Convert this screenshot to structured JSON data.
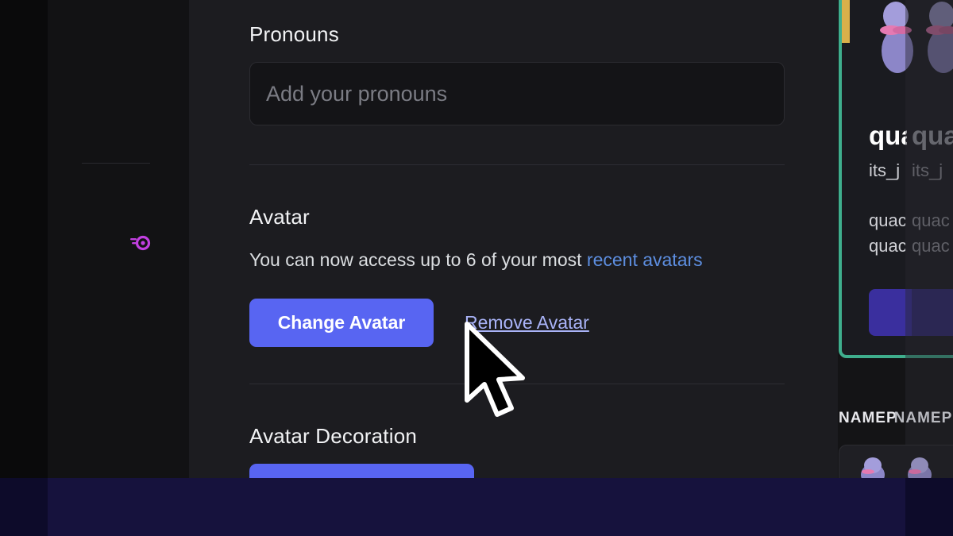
{
  "pronouns": {
    "title": "Pronouns",
    "placeholder": "Add your pronouns"
  },
  "avatar": {
    "title": "Avatar",
    "description_prefix": "You can now access up to 6 of your most ",
    "description_link": "recent avatars",
    "change_button": "Change Avatar",
    "remove_link": "Remove Avatar"
  },
  "avatar_decoration": {
    "title": "Avatar Decoration"
  },
  "preview": {
    "name_partial": "qua",
    "name_ghost": "qua",
    "username_partial": "its_j",
    "username_ghost": "its_j",
    "bio_line1_partial": "quac",
    "bio_line1_ghost": "quac",
    "bio_line2_partial": "quac",
    "bio_line2_ghost": "quac",
    "nameplate_label": "NAMEP",
    "nameplate_label_ghost": "NAMEP"
  },
  "colors": {
    "accent": "#5865f2",
    "link": "#5d8ee0",
    "card_border": "#3fae8d",
    "nitro": "#c13fe0"
  },
  "icons": {
    "nitro": "nitro-icon",
    "cursor": "cursor-arrow-icon"
  }
}
